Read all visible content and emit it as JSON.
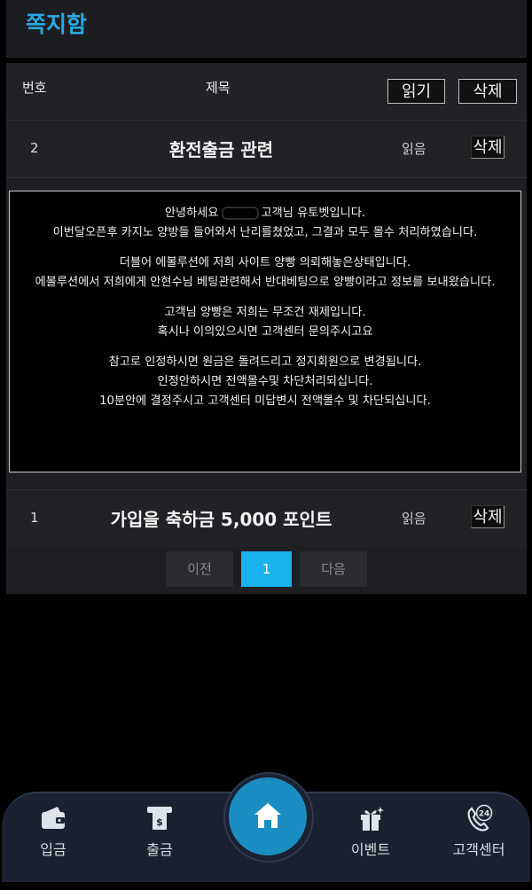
{
  "header": {
    "title": "쪽지함"
  },
  "table": {
    "col_no": "번호",
    "col_title": "제목",
    "read_button": "읽기",
    "delete_button": "삭제"
  },
  "messages": [
    {
      "no": "2",
      "title": "환전출금 관련",
      "status": "읽음",
      "delete_label": "삭제",
      "body": {
        "greeting_before": "안녕하세요",
        "greeting_after": "고객님 유토벳입니다.",
        "p1_rest": "이번달오픈후 카지노 양방들 들어와서 난리를쳤었고, 그결과 모두 몰수 처리하였습니다.",
        "p2_line1": "더블어 에볼루션에 저희 사이트 양빵 의뢰해놓은상태입니다.",
        "p2_line2": "에볼루션에서 저희에게 안현수님 베팅관련해서 반대베팅으로 양빵이라고 정보를 보내왔습니다.",
        "p3_line1": "고객님 양빵은 저희는 무조건 재제입니다.",
        "p3_line2": "혹시나 이의있으시면 고객센터 문의주시고요",
        "p4_line1": "참고로 인정하시면 원금은 돌려드리고 정지회원으로 변경됩니다.",
        "p4_line2": "인정안하시면 전액몰수및 차단처리되십니다.",
        "p4_line3": "10분안에 결정주시고 고객센터 미답변시 전액몰수 및 차단되십니다."
      }
    },
    {
      "no": "1",
      "title": "가입을 축하금 5,000 포인트",
      "status": "읽음",
      "delete_label": "삭제"
    }
  ],
  "pagination": {
    "prev": "이전",
    "current": "1",
    "next": "다음"
  },
  "bottom_nav": {
    "deposit": "입금",
    "withdraw": "출금",
    "event": "이벤트",
    "support": "고객센터",
    "support_badge": "24"
  },
  "colors": {
    "accent": "#29a8e0",
    "active_page": "#16b3ee",
    "home": "#1a8ec2"
  }
}
